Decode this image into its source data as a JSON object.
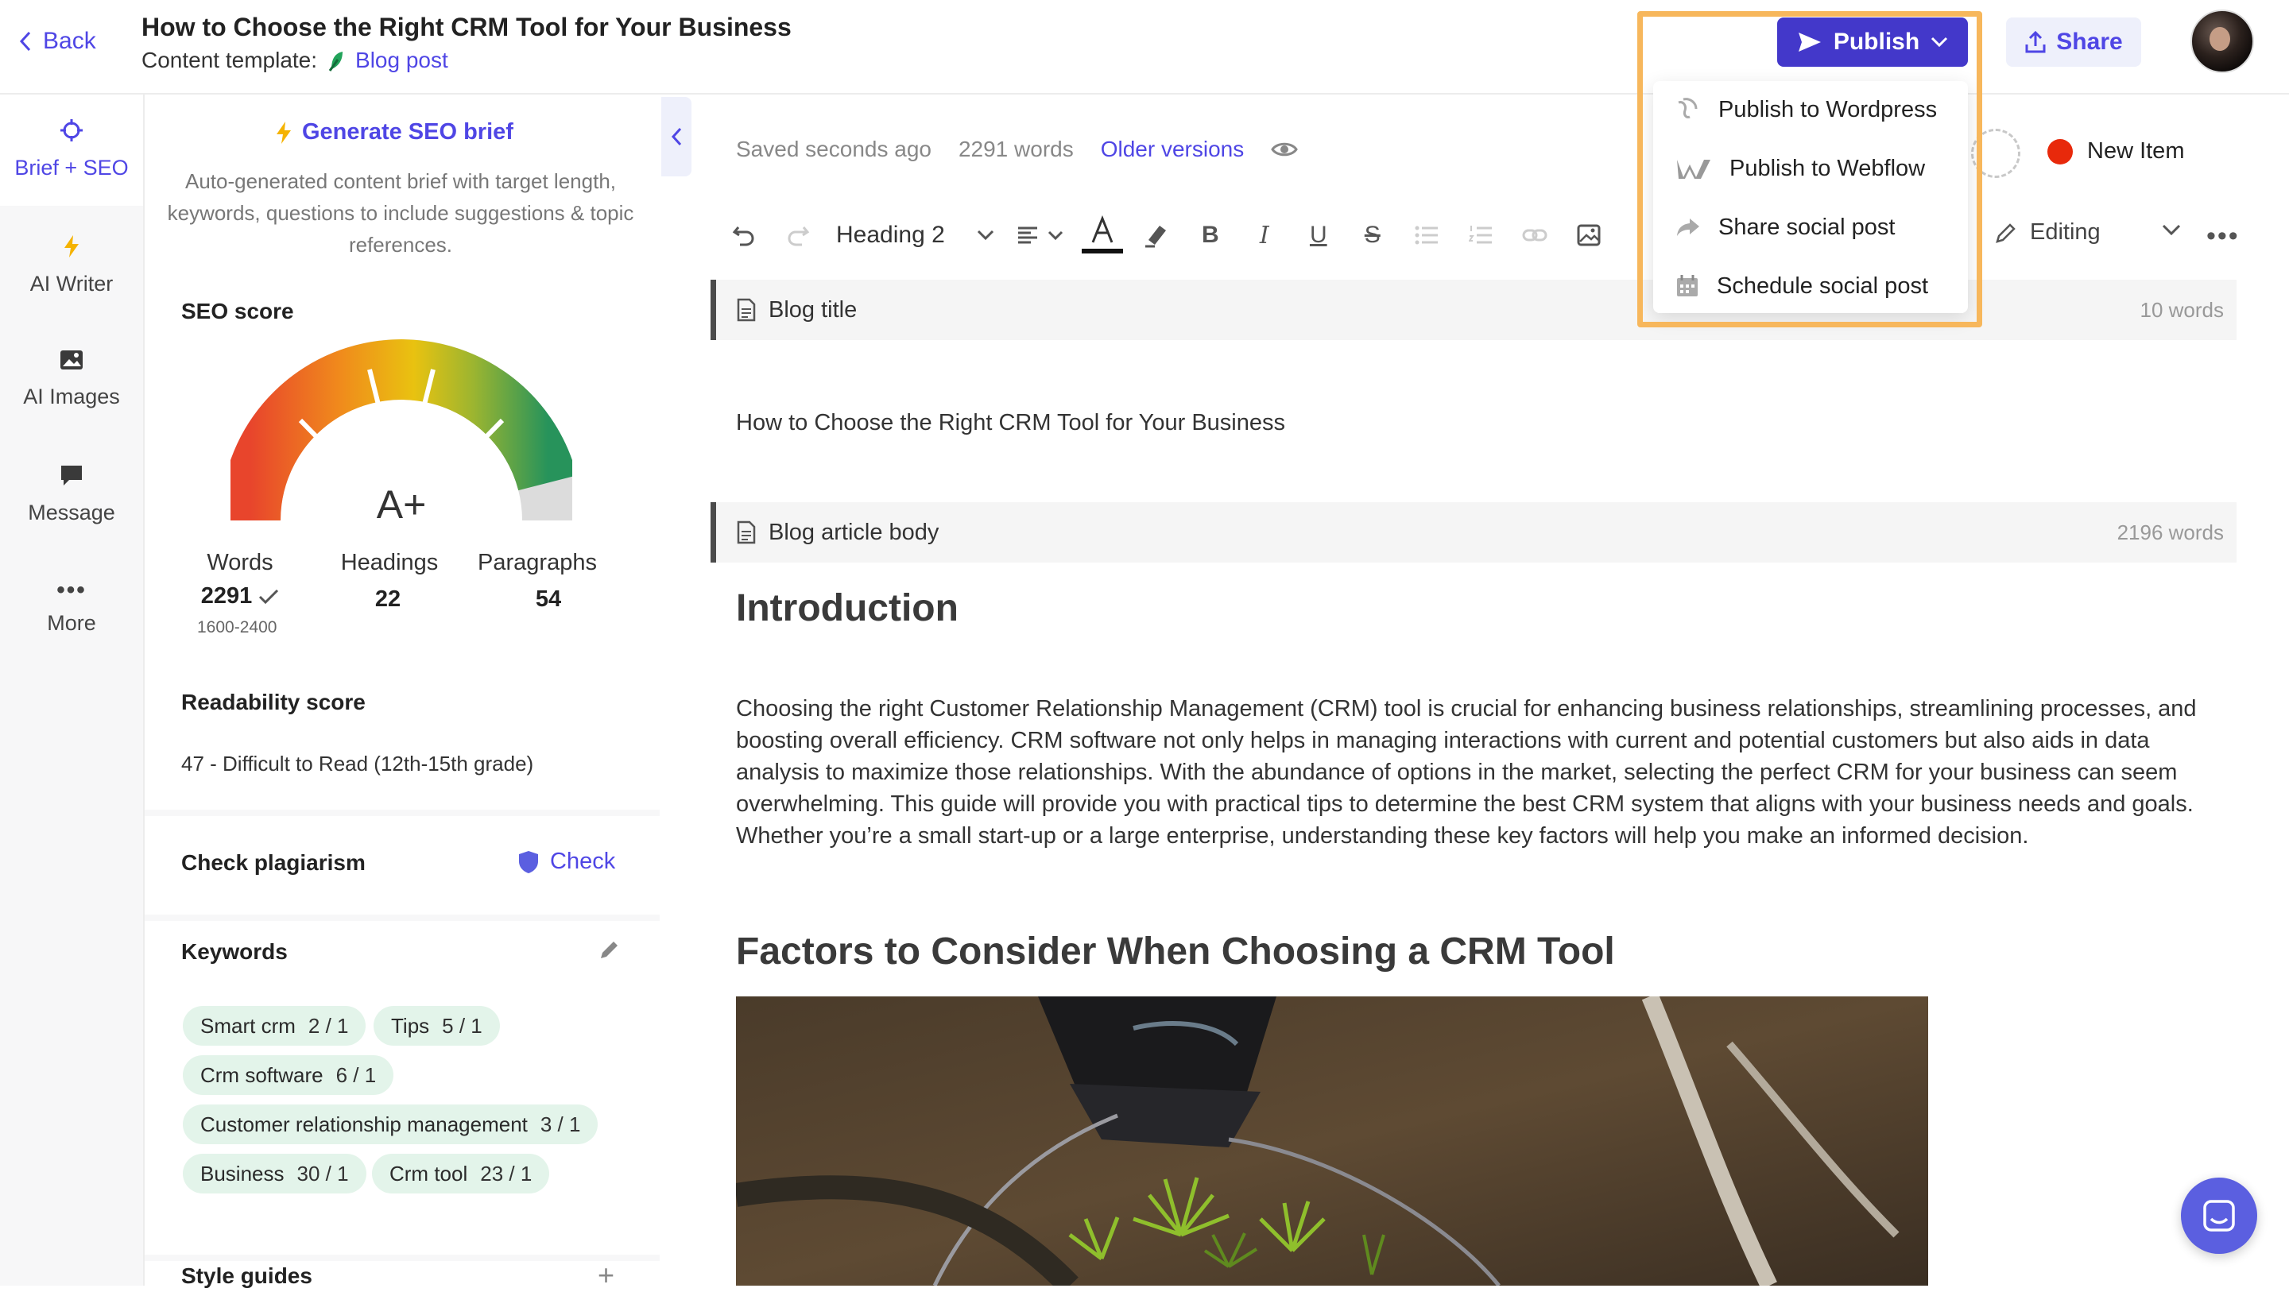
{
  "header": {
    "back_label": "Back",
    "doc_title": "How to Choose the Right CRM Tool for Your Business",
    "template_prefix": "Content template:",
    "template_name": "Blog post",
    "publish_label": "Publish",
    "share_label": "Share"
  },
  "publish_menu": {
    "items": [
      {
        "label": "Publish to Wordpress",
        "icon": "wordpress-icon"
      },
      {
        "label": "Publish to Webflow",
        "icon": "webflow-icon"
      },
      {
        "label": "Share social post",
        "icon": "share-arrow-icon"
      },
      {
        "label": "Schedule social post",
        "icon": "calendar-icon"
      }
    ]
  },
  "nav": {
    "items": [
      {
        "label": "Brief + SEO",
        "icon": "crosshair-icon",
        "active": true
      },
      {
        "label": "AI Writer",
        "icon": "lightning-icon"
      },
      {
        "label": "AI Images",
        "icon": "image-icon"
      },
      {
        "label": "Message",
        "icon": "chat-icon"
      },
      {
        "label": "More",
        "icon": "ellipsis-icon"
      }
    ]
  },
  "seo_panel": {
    "generate_label": "Generate SEO brief",
    "description": "Auto-generated content brief with target length, keywords, questions to include suggestions & topic references.",
    "seo_score_label": "SEO score",
    "grade": "A+",
    "gauge_level": 0.92,
    "stats": {
      "words_label": "Words",
      "words_value": "2291",
      "words_range": "1600-2400",
      "headings_label": "Headings",
      "headings_value": "22",
      "paragraphs_label": "Paragraphs",
      "paragraphs_value": "54"
    },
    "readability_label": "Readability score",
    "readability_value": "47 - Difficult to Read (12th-15th grade)",
    "plagiarism_label": "Check plagiarism",
    "check_label": "Check",
    "keywords_label": "Keywords",
    "keywords": [
      {
        "name": "Smart crm",
        "count": "2 / 1"
      },
      {
        "name": "Tips",
        "count": "5 / 1"
      },
      {
        "name": "Crm software",
        "count": "6 / 1"
      },
      {
        "name": "Customer relationship management",
        "count": "3 / 1"
      },
      {
        "name": "Business",
        "count": "30 / 1"
      },
      {
        "name": "Crm tool",
        "count": "23 / 1"
      }
    ],
    "style_guides_label": "Style guides"
  },
  "editor": {
    "saved_status": "Saved seconds ago",
    "word_count": "2291 words",
    "older_versions": "Older versions",
    "new_item_label": "New Item",
    "heading_select": "Heading 2",
    "editing_mode": "Editing",
    "blog_title_label": "Blog title",
    "blog_title_count": "10 words",
    "blog_title_text": "How to Choose the Right CRM Tool for Your Business",
    "body_label": "Blog article body",
    "body_count": "2196 words",
    "h_intro": "Introduction",
    "intro_paragraph": "Choosing the right Customer Relationship Management (CRM) tool is crucial for enhancing business relationships, streamlining processes, and boosting overall efficiency. CRM software not only helps in managing interactions with current and potential customers but also aids in data analysis to maximize those relationships. With the abundance of options in the market, selecting the perfect CRM for your business can seem overwhelming. This guide will provide you with practical tips to determine the best CRM system that aligns with your business needs and goals. Whether you’re a small start-up or a large enterprise, understanding these key factors will help you make an informed decision.",
    "h_factors": "Factors to Consider When Choosing a CRM Tool"
  },
  "colors": {
    "accent": "#4f46e5",
    "publish_bg": "#4338ca",
    "highlight": "#f7b75c",
    "status_dot": "#e8290b",
    "chip_bg": "#e3f4ea"
  }
}
